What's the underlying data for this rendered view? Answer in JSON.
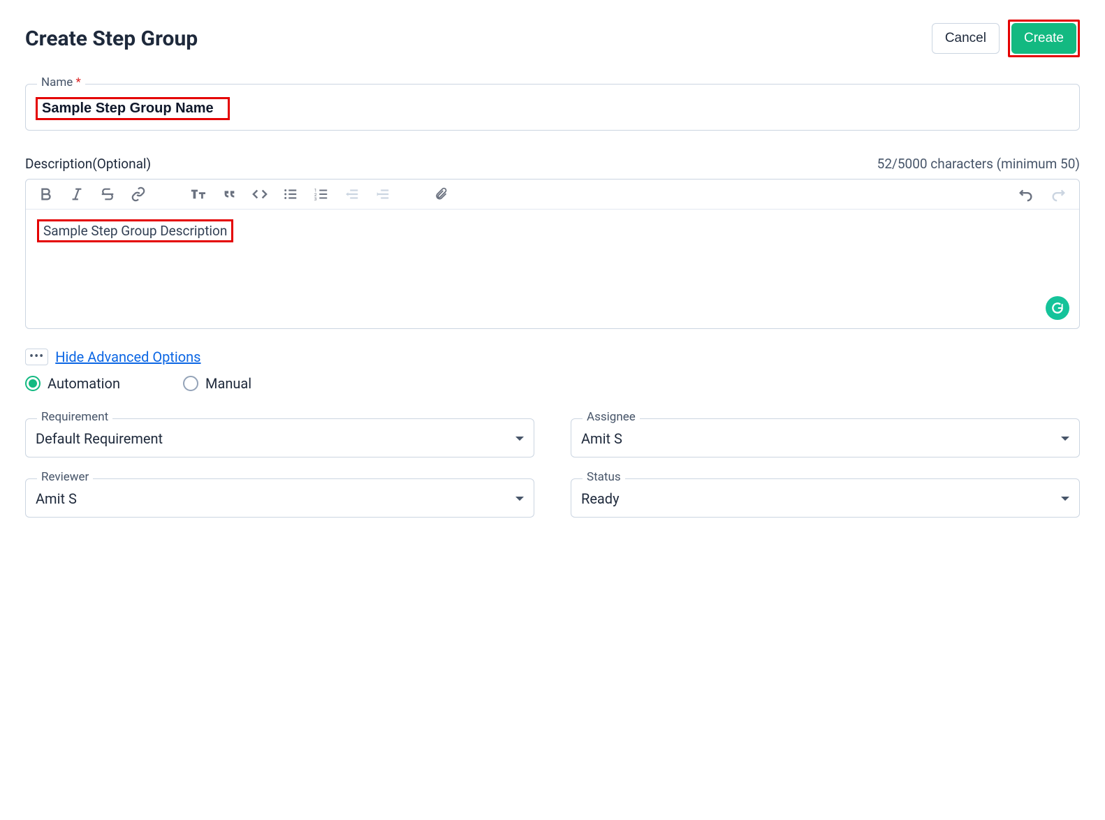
{
  "header": {
    "title": "Create Step Group",
    "cancel_label": "Cancel",
    "create_label": "Create"
  },
  "name_field": {
    "label": "Name",
    "required_mark": "*",
    "value": "Sample Step Group Name"
  },
  "description": {
    "label": "Description(Optional)",
    "counter": "52/5000 characters (minimum 50)",
    "value": "Sample Step Group Description"
  },
  "advanced": {
    "dots": "•••",
    "toggle_label": "Hide Advanced Options",
    "radios": {
      "automation": "Automation",
      "manual": "Manual",
      "selected": "automation"
    }
  },
  "selects": {
    "requirement": {
      "label": "Requirement",
      "value": "Default Requirement"
    },
    "assignee": {
      "label": "Assignee",
      "value": "Amit S"
    },
    "reviewer": {
      "label": "Reviewer",
      "value": "Amit S"
    },
    "status": {
      "label": "Status",
      "value": "Ready"
    }
  }
}
